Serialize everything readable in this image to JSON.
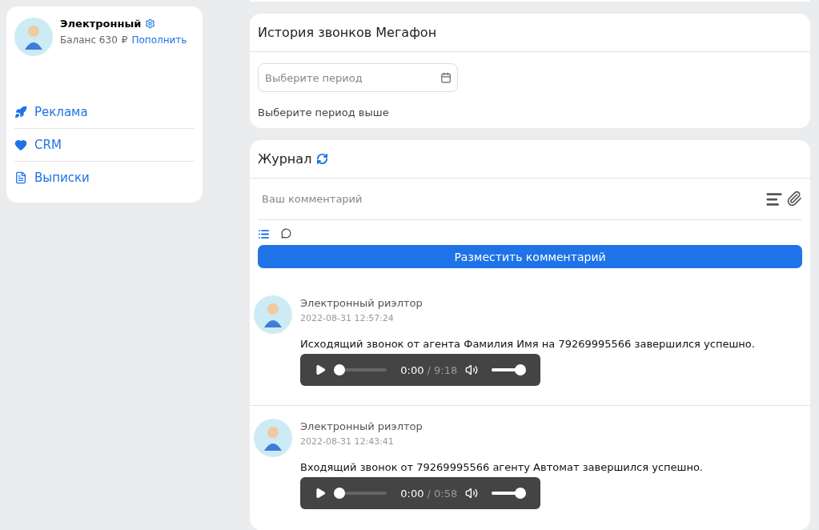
{
  "profile": {
    "name": "Электронный",
    "balance_label": "Баланс 630",
    "currency": "₽",
    "topup_link": "Пополнить"
  },
  "sidebar": {
    "items": [
      {
        "label": "Реклама",
        "kind": "rocket"
      },
      {
        "label": "CRM",
        "kind": "heart"
      },
      {
        "label": "Выписки",
        "kind": "document"
      }
    ]
  },
  "call_history": {
    "title": "История звонков Мегафон",
    "period_field": {
      "placeholder": "Выберите период"
    },
    "hint": "Выберите период выше"
  },
  "journal": {
    "title": "Журнал",
    "comment_field": {
      "placeholder": "Ваш комментарий"
    },
    "submit_button": "Разместить комментарий",
    "entries": [
      {
        "author": "Электронный риэлтор",
        "time": "2022-08-31 12:57:24",
        "text": "Исходящий звонок от агента Фамилия Имя на 79269995566 завершился успешно.",
        "player": {
          "current": "0:00",
          "duration": "/ 9:18",
          "level": 0,
          "volume": {
            "level": 1
          }
        }
      },
      {
        "author": "Электронный риэлтор",
        "time": "2022-08-31 12:43:41",
        "text": "Входящий звонок от 79269995566 агенту Автомат завершился успешно.",
        "player": {
          "current": "0:00",
          "duration": "/ 0:58",
          "level": 0,
          "volume": {
            "level": 1
          }
        }
      }
    ]
  }
}
